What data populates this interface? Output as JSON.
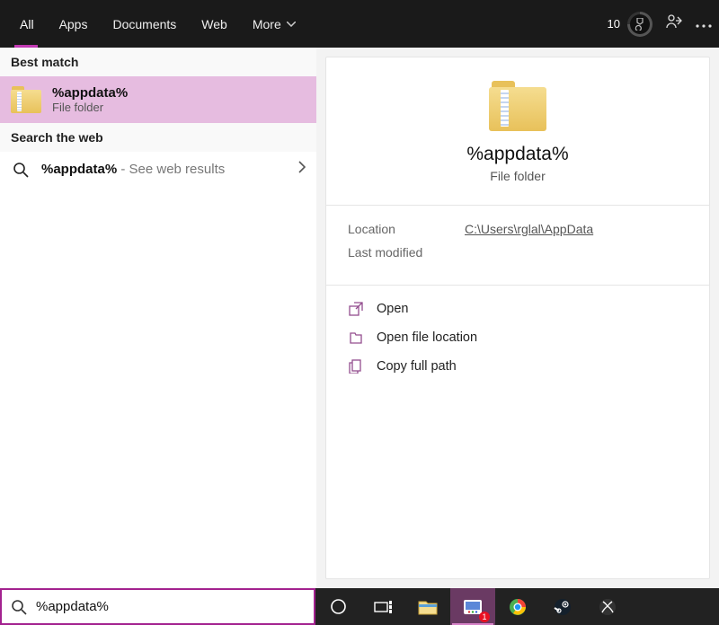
{
  "topbar": {
    "tabs": [
      {
        "label": "All",
        "active": true
      },
      {
        "label": "Apps"
      },
      {
        "label": "Documents"
      },
      {
        "label": "Web"
      },
      {
        "label": "More"
      }
    ],
    "rewards": "10"
  },
  "left": {
    "best_match_header": "Best match",
    "best_match": {
      "title": "%appdata%",
      "subtitle": "File folder"
    },
    "web_header": "Search the web",
    "web_item": {
      "query": "%appdata%",
      "suffix": " - See web results"
    }
  },
  "preview": {
    "title": "%appdata%",
    "subtitle": "File folder",
    "location_label": "Location",
    "location_value": "C:\\Users\\rglal\\AppData",
    "modified_label": "Last modified",
    "actions": {
      "open": "Open",
      "open_location": "Open file location",
      "copy_path": "Copy full path"
    }
  },
  "searchbox": {
    "value": "%appdata%"
  },
  "taskbar": {
    "badge": "1"
  }
}
